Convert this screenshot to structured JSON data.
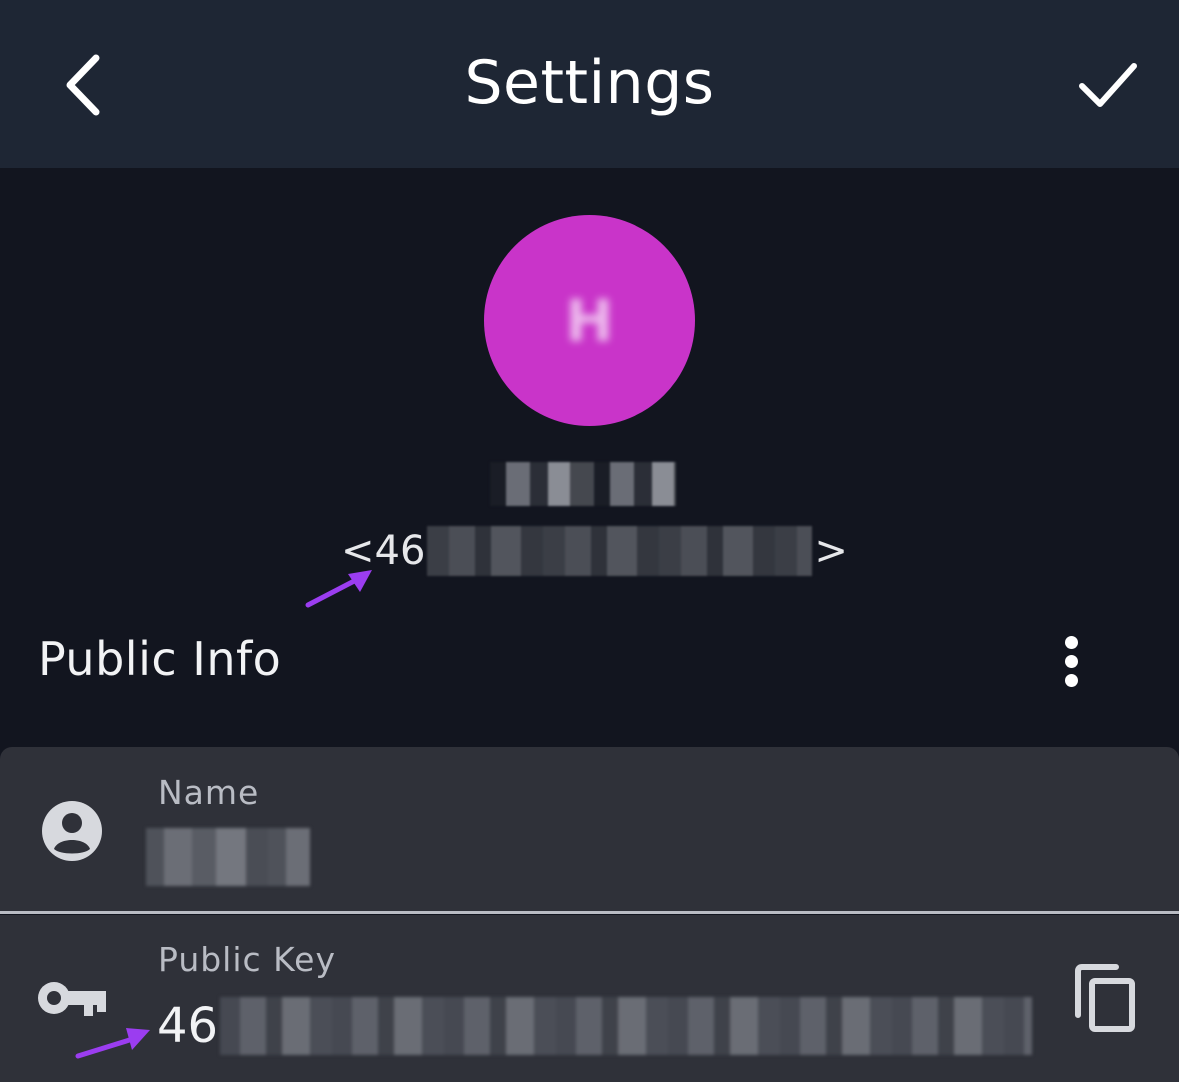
{
  "header": {
    "title": "Settings"
  },
  "profile": {
    "avatar_color": "#c934c9",
    "avatar_initial": "H",
    "id_prefix": "<46",
    "id_suffix": ">"
  },
  "section": {
    "title": "Public Info"
  },
  "fields": {
    "name": {
      "label": "Name",
      "icon": "person-icon"
    },
    "public_key": {
      "label": "Public Key",
      "value_prefix": "46",
      "icon": "key-icon",
      "action_icon": "copy-icon"
    }
  },
  "colors": {
    "header_bg": "#1e2634",
    "page_bg": "#12151f",
    "card_bg": "#2f3139",
    "annotation_arrow": "#9b3df0"
  }
}
